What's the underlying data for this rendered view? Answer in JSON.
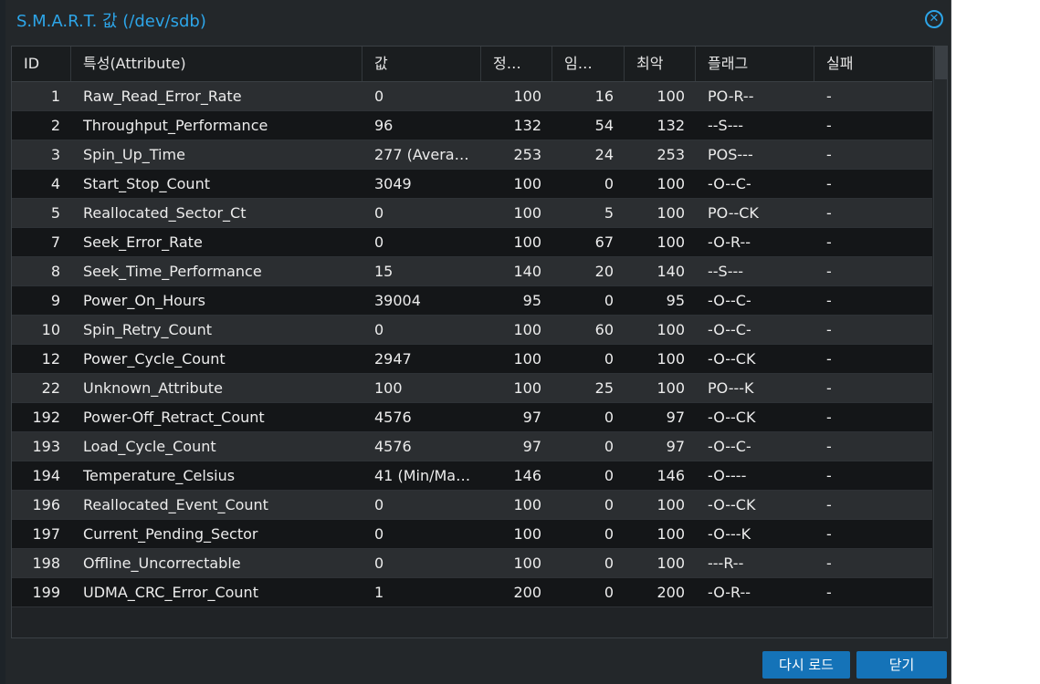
{
  "dialog": {
    "title": "S.M.A.R.T. 값 (/dev/sdb)",
    "close_icon": "circle-x-icon"
  },
  "table": {
    "columns": [
      "ID",
      "특성(Attribute)",
      "값",
      "정…",
      "임…",
      "최악",
      "플래그",
      "실패"
    ],
    "rows": [
      {
        "id": "1",
        "attr": "Raw_Read_Error_Rate",
        "value": "0",
        "normalized": "100",
        "threshold": "16",
        "worst": "100",
        "flags": "PO-R--",
        "fail": "-"
      },
      {
        "id": "2",
        "attr": "Throughput_Performance",
        "value": "96",
        "normalized": "132",
        "threshold": "54",
        "worst": "132",
        "flags": "--S---",
        "fail": "-"
      },
      {
        "id": "3",
        "attr": "Spin_Up_Time",
        "value": "277 (Avera…",
        "normalized": "253",
        "threshold": "24",
        "worst": "253",
        "flags": "POS---",
        "fail": "-"
      },
      {
        "id": "4",
        "attr": "Start_Stop_Count",
        "value": "3049",
        "normalized": "100",
        "threshold": "0",
        "worst": "100",
        "flags": "-O--C-",
        "fail": "-"
      },
      {
        "id": "5",
        "attr": "Reallocated_Sector_Ct",
        "value": "0",
        "normalized": "100",
        "threshold": "5",
        "worst": "100",
        "flags": "PO--CK",
        "fail": "-"
      },
      {
        "id": "7",
        "attr": "Seek_Error_Rate",
        "value": "0",
        "normalized": "100",
        "threshold": "67",
        "worst": "100",
        "flags": "-O-R--",
        "fail": "-"
      },
      {
        "id": "8",
        "attr": "Seek_Time_Performance",
        "value": "15",
        "normalized": "140",
        "threshold": "20",
        "worst": "140",
        "flags": "--S---",
        "fail": "-"
      },
      {
        "id": "9",
        "attr": "Power_On_Hours",
        "value": "39004",
        "normalized": "95",
        "threshold": "0",
        "worst": "95",
        "flags": "-O--C-",
        "fail": "-"
      },
      {
        "id": "10",
        "attr": "Spin_Retry_Count",
        "value": "0",
        "normalized": "100",
        "threshold": "60",
        "worst": "100",
        "flags": "-O--C-",
        "fail": "-"
      },
      {
        "id": "12",
        "attr": "Power_Cycle_Count",
        "value": "2947",
        "normalized": "100",
        "threshold": "0",
        "worst": "100",
        "flags": "-O--CK",
        "fail": "-"
      },
      {
        "id": "22",
        "attr": "Unknown_Attribute",
        "value": "100",
        "normalized": "100",
        "threshold": "25",
        "worst": "100",
        "flags": "PO---K",
        "fail": "-"
      },
      {
        "id": "192",
        "attr": "Power-Off_Retract_Count",
        "value": "4576",
        "normalized": "97",
        "threshold": "0",
        "worst": "97",
        "flags": "-O--CK",
        "fail": "-"
      },
      {
        "id": "193",
        "attr": "Load_Cycle_Count",
        "value": "4576",
        "normalized": "97",
        "threshold": "0",
        "worst": "97",
        "flags": "-O--C-",
        "fail": "-"
      },
      {
        "id": "194",
        "attr": "Temperature_Celsius",
        "value": "41 (Min/Ma…",
        "normalized": "146",
        "threshold": "0",
        "worst": "146",
        "flags": "-O----",
        "fail": "-"
      },
      {
        "id": "196",
        "attr": "Reallocated_Event_Count",
        "value": "0",
        "normalized": "100",
        "threshold": "0",
        "worst": "100",
        "flags": "-O--CK",
        "fail": "-"
      },
      {
        "id": "197",
        "attr": "Current_Pending_Sector",
        "value": "0",
        "normalized": "100",
        "threshold": "0",
        "worst": "100",
        "flags": "-O---K",
        "fail": "-"
      },
      {
        "id": "198",
        "attr": "Offline_Uncorrectable",
        "value": "0",
        "normalized": "100",
        "threshold": "0",
        "worst": "100",
        "flags": "---R--",
        "fail": "-"
      },
      {
        "id": "199",
        "attr": "UDMA_CRC_Error_Count",
        "value": "1",
        "normalized": "200",
        "threshold": "0",
        "worst": "200",
        "flags": "-O-R--",
        "fail": "-"
      }
    ]
  },
  "footer": {
    "reload_label": "다시 로드",
    "close_label": "닫기"
  },
  "colors": {
    "accent": "#2da5e8",
    "button": "#1573b8",
    "background": "#23272a"
  }
}
